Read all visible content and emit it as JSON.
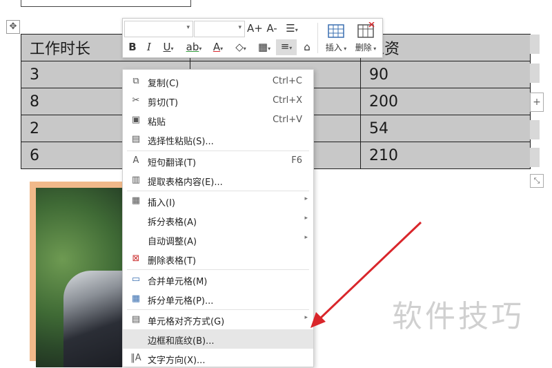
{
  "toolbar": {
    "font_size_up": "A+",
    "font_size_down": "A-",
    "bold": "B",
    "italic": "I",
    "underline": "U",
    "highlight": "ab",
    "font_color": "A",
    "insert_label": "插入",
    "delete_label": "删除"
  },
  "table": {
    "rows": [
      [
        "工作时长",
        "",
        "工资"
      ],
      [
        "3",
        "",
        "90"
      ],
      [
        "8",
        "",
        "200"
      ],
      [
        "2",
        "",
        "54"
      ],
      [
        "6",
        "",
        "210"
      ]
    ]
  },
  "context_menu": {
    "items": [
      {
        "label": "复制(C)",
        "shortcut": "Ctrl+C",
        "icon": "copy-icon"
      },
      {
        "label": "剪切(T)",
        "shortcut": "Ctrl+X",
        "icon": "scissors-icon"
      },
      {
        "label": "粘贴",
        "shortcut": "Ctrl+V",
        "icon": "paste-icon"
      },
      {
        "label": "选择性粘贴(S)...",
        "shortcut": "",
        "icon": "paste-special-icon"
      },
      {
        "label": "短句翻译(T)",
        "shortcut": "F6",
        "icon": "translate-icon"
      },
      {
        "label": "提取表格内容(E)...",
        "shortcut": "",
        "icon": "extract-icon"
      },
      {
        "label": "插入(I)",
        "shortcut": "",
        "icon": "table-icon"
      },
      {
        "label": "拆分表格(A)",
        "shortcut": "",
        "icon": ""
      },
      {
        "label": "自动调整(A)",
        "shortcut": "",
        "icon": ""
      },
      {
        "label": "删除表格(T)",
        "shortcut": "",
        "icon": "delete-table-icon"
      },
      {
        "label": "合并单元格(M)",
        "shortcut": "",
        "icon": "merge-cells-icon"
      },
      {
        "label": "拆分单元格(P)...",
        "shortcut": "",
        "icon": "split-cells-icon"
      },
      {
        "label": "单元格对齐方式(G)",
        "shortcut": "",
        "icon": "cell-align-icon"
      },
      {
        "label": "边框和底纹(B)...",
        "shortcut": "",
        "icon": ""
      },
      {
        "label": "文字方向(X)...",
        "shortcut": "",
        "icon": "text-direction-icon"
      }
    ]
  },
  "watermark": "软件技巧",
  "colors": {
    "table_fill": "#c8c8c8",
    "arrow": "#d9262b",
    "menu_highlight": "#e6e6e6"
  }
}
